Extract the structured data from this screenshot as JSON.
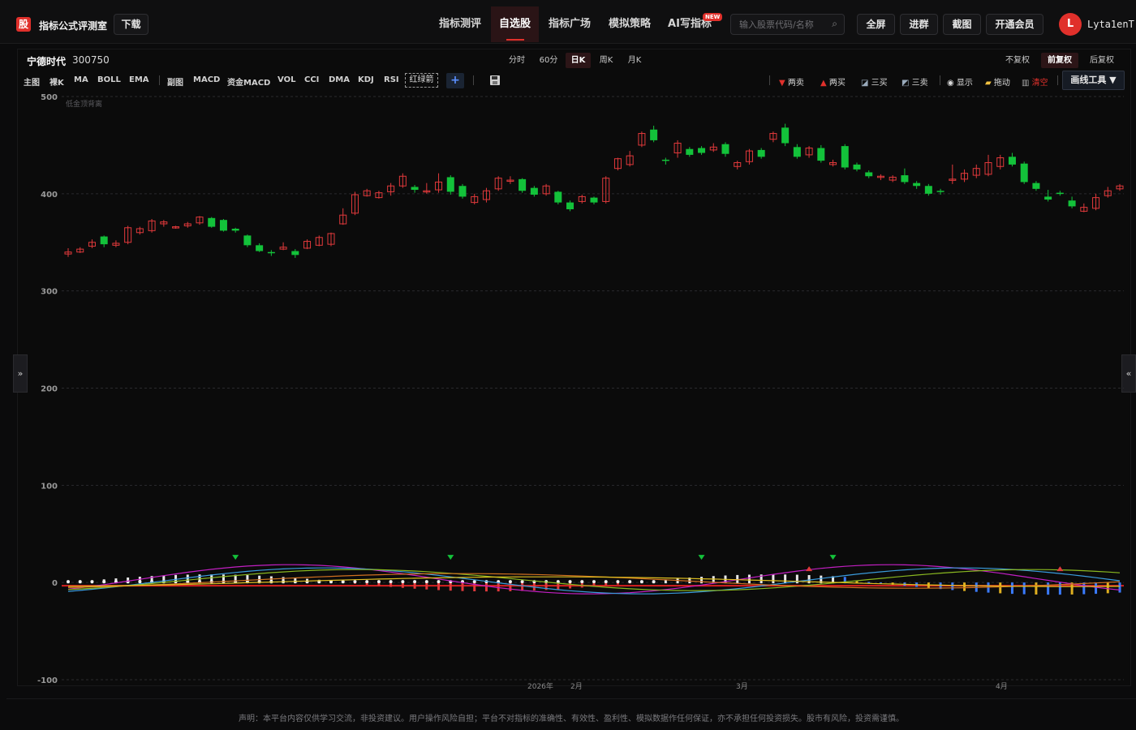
{
  "app": {
    "logo_char": "股",
    "title": "指标公式评测室",
    "download_label": "下载"
  },
  "nav": {
    "items": [
      "指标测评",
      "自选股",
      "指标广场",
      "模拟策略",
      "AI写指标"
    ],
    "active": "自选股",
    "new_badge": "NEW"
  },
  "search": {
    "placeholder": "输入股票代码/名称",
    "value": ""
  },
  "header_buttons": {
    "fullscreen": "全屏",
    "join_group": "进群",
    "screenshot": "截图",
    "membership": "开通会员"
  },
  "user": {
    "initial": "L",
    "name": "Lyta1enT"
  },
  "stock": {
    "name": "宁德时代",
    "code": "300750"
  },
  "periods": [
    "分时",
    "60分",
    "日K",
    "周K",
    "月K"
  ],
  "active_period": "日K",
  "adjust": [
    "不复权",
    "前复权",
    "后复权"
  ],
  "active_adjust": "前复权",
  "indicators": [
    "主图",
    "裸K",
    "MA",
    "BOLL",
    "EMA",
    "副图",
    "MACD",
    "资金MACD",
    "VOL",
    "CCI",
    "DMA",
    "KDJ",
    "RSI",
    "红绿箭"
  ],
  "tools": {
    "two_sell": "两卖",
    "two_buy": "两买",
    "three_buy": "三买",
    "three_sell": "三卖",
    "show": "显示",
    "drag": "拖动",
    "clear": "清空",
    "draw_tools": "画线工具 ▼"
  },
  "side_tabs": {
    "left": "»",
    "right": "«"
  },
  "footer": "声明：本平台内容仅供学习交流，非投资建议。用户操作风险自担；平台不对指标的准确性、有效性、盈利性、模拟数据作任何保证，亦不承担任何投资损失。股市有风险，投资需谨慎。",
  "colors": {
    "up": "#e0393b",
    "down": "#13c23a",
    "accent": "#e0302b"
  },
  "chart_data": {
    "type": "candlestick",
    "watermark": "低金顶背离",
    "y_ticks": [
      500,
      400,
      300,
      200,
      100,
      0,
      -100
    ],
    "x_labels": [
      "2026年",
      "2月",
      "3月",
      "4月"
    ],
    "ylim": [
      -100,
      500
    ],
    "candles": [
      [
        338,
        340,
        335,
        344
      ],
      [
        340,
        343,
        339,
        345
      ],
      [
        346,
        350,
        344,
        353
      ],
      [
        356,
        348,
        345,
        357
      ],
      [
        347,
        349,
        345,
        352
      ],
      [
        350,
        365,
        348,
        367
      ],
      [
        360,
        364,
        358,
        366
      ],
      [
        362,
        372,
        360,
        374
      ],
      [
        369,
        371,
        366,
        373
      ],
      [
        366,
        366,
        364,
        367
      ],
      [
        367,
        369,
        365,
        371
      ],
      [
        370,
        376,
        368,
        377
      ],
      [
        375,
        366,
        365,
        376
      ],
      [
        373,
        362,
        361,
        374
      ],
      [
        364,
        362,
        360,
        365
      ],
      [
        357,
        347,
        345,
        358
      ],
      [
        347,
        341,
        340,
        349
      ],
      [
        340,
        339,
        336,
        342
      ],
      [
        343,
        345,
        342,
        350
      ],
      [
        341,
        337,
        334,
        343
      ],
      [
        344,
        351,
        343,
        353
      ],
      [
        347,
        355,
        346,
        357
      ],
      [
        348,
        359,
        346,
        360
      ],
      [
        369,
        378,
        368,
        385
      ],
      [
        380,
        399,
        378,
        402
      ],
      [
        398,
        403,
        397,
        405
      ],
      [
        396,
        401,
        395,
        403
      ],
      [
        402,
        408,
        398,
        411
      ],
      [
        408,
        418,
        406,
        421
      ],
      [
        407,
        404,
        401,
        409
      ],
      [
        402,
        403,
        400,
        411
      ],
      [
        404,
        412,
        401,
        421
      ],
      [
        417,
        402,
        399,
        419
      ],
      [
        408,
        397,
        395,
        410
      ],
      [
        391,
        397,
        389,
        400
      ],
      [
        394,
        403,
        391,
        406
      ],
      [
        405,
        416,
        403,
        418
      ],
      [
        414,
        414,
        410,
        418
      ],
      [
        415,
        403,
        401,
        416
      ],
      [
        406,
        399,
        397,
        408
      ],
      [
        400,
        408,
        398,
        410
      ],
      [
        402,
        391,
        389,
        403
      ],
      [
        391,
        384,
        382,
        393
      ],
      [
        392,
        397,
        390,
        399
      ],
      [
        396,
        391,
        389,
        397
      ],
      [
        392,
        416,
        390,
        418
      ],
      [
        426,
        436,
        424,
        437
      ],
      [
        430,
        439,
        428,
        444
      ],
      [
        450,
        462,
        448,
        464
      ],
      [
        466,
        455,
        453,
        470
      ],
      [
        435,
        434,
        430,
        437
      ],
      [
        442,
        452,
        437,
        455
      ],
      [
        446,
        440,
        438,
        448
      ],
      [
        447,
        442,
        440,
        449
      ],
      [
        445,
        448,
        443,
        452
      ],
      [
        451,
        441,
        438,
        453
      ],
      [
        428,
        432,
        425,
        434
      ],
      [
        433,
        444,
        430,
        446
      ],
      [
        445,
        438,
        436,
        447
      ],
      [
        456,
        462,
        453,
        464
      ],
      [
        468,
        452,
        449,
        472
      ],
      [
        448,
        438,
        436,
        451
      ],
      [
        440,
        447,
        437,
        449
      ],
      [
        447,
        434,
        432,
        450
      ],
      [
        430,
        432,
        428,
        435
      ],
      [
        449,
        427,
        425,
        451
      ],
      [
        430,
        425,
        423,
        432
      ],
      [
        422,
        418,
        416,
        424
      ],
      [
        418,
        418,
        414,
        420
      ],
      [
        414,
        417,
        412,
        419
      ],
      [
        419,
        412,
        410,
        426
      ],
      [
        411,
        408,
        405,
        413
      ],
      [
        408,
        400,
        398,
        410
      ],
      [
        403,
        402,
        399,
        405
      ],
      [
        415,
        415,
        410,
        430
      ],
      [
        415,
        421,
        412,
        425
      ],
      [
        419,
        426,
        416,
        430
      ],
      [
        420,
        432,
        418,
        440
      ],
      [
        428,
        437,
        425,
        440
      ],
      [
        438,
        430,
        428,
        442
      ],
      [
        431,
        412,
        410,
        433
      ],
      [
        411,
        405,
        403,
        413
      ],
      [
        397,
        394,
        392,
        404
      ],
      [
        401,
        400,
        398,
        403
      ],
      [
        393,
        387,
        385,
        397
      ],
      [
        382,
        386,
        381,
        390
      ],
      [
        385,
        396,
        383,
        400
      ],
      [
        398,
        403,
        396,
        407
      ],
      [
        405,
        408,
        403,
        410
      ]
    ]
  }
}
